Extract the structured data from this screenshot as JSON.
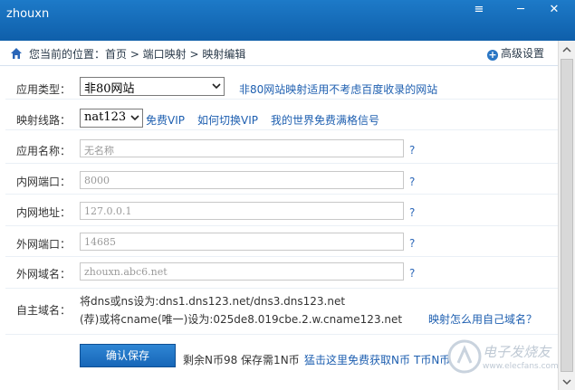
{
  "window": {
    "title": "zhouxn"
  },
  "controls": {
    "menu_glyph": "≡",
    "minimize_glyph": "─",
    "close_glyph": "✕"
  },
  "breadcrumb": {
    "text": "您当前的位置：首页 > 端口映射 > 映射编辑",
    "advanced_settings": "高级设置"
  },
  "form": {
    "app_type": {
      "label": "应用类型：",
      "value": "非80网站",
      "note": "非80网站映射适用不考虑百度收录的网站"
    },
    "line": {
      "label": "映射线路：",
      "value": "nat123",
      "link_vip": "免费VIP",
      "link_switch": "如何切换VIP",
      "link_world": "我的世界免费满格信号"
    },
    "app_name": {
      "label": "应用名称：",
      "placeholder": "无名称"
    },
    "lan_port": {
      "label": "内网端口：",
      "value": "8000"
    },
    "lan_addr": {
      "label": "内网地址：",
      "value": "127.0.0.1"
    },
    "wan_port": {
      "label": "外网端口：",
      "value": "14685"
    },
    "wan_domain": {
      "label": "外网域名：",
      "value": "zhouxn.abc6.net"
    },
    "custom_domain": {
      "label": "自主域名：",
      "line1": "将dns或ns设为:dns1.dns123.net/dns3.dns123.net",
      "line2": "(荐)或将cname(唯一)设为:025de8.019cbe.2.w.cname123.net",
      "help_link": "映射怎么用自己域名？"
    },
    "help": "?"
  },
  "footer": {
    "save_button": "确认保存",
    "balance_text": "剩余N币98 保存需1N币",
    "free_link": "猛击这里免费获取N币",
    "tail_text": "T币N币"
  },
  "watermark": {
    "text_cn": "电子发烧友",
    "text_en": "www.elecfans.com"
  },
  "colors": {
    "titlebar": "#1a72c2",
    "link": "#1e5fb0",
    "button": "#2477c6"
  },
  "icons": [
    "home-icon",
    "plus-icon",
    "menu-icon",
    "minimize-icon",
    "close-icon",
    "dropdown-caret-icon"
  ]
}
